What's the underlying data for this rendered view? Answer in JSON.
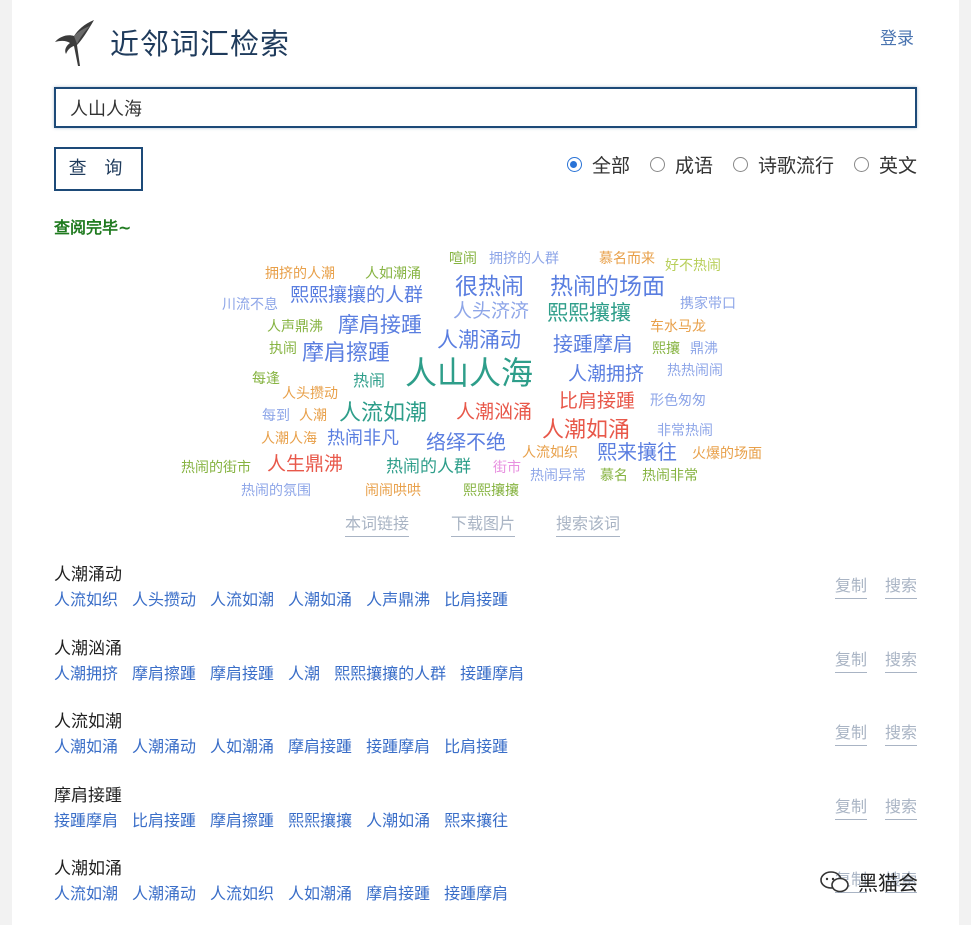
{
  "header": {
    "title": "近邻词汇检索",
    "login": "登录"
  },
  "search": {
    "value": "人山人海",
    "button": "查 询"
  },
  "filters": [
    {
      "label": "全部",
      "checked": true
    },
    {
      "label": "成语",
      "checked": false
    },
    {
      "label": "诗歌流行",
      "checked": false
    },
    {
      "label": "英文",
      "checked": false
    }
  ],
  "status": "查阅完毕~",
  "wordcloud": [
    {
      "text": "喧闹",
      "color": "#86b341"
    },
    {
      "text": "拥挤的人群",
      "color": "#8ea6e8"
    },
    {
      "text": "慕名而来",
      "color": "#e8a04a"
    },
    {
      "text": "好不热闹",
      "color": "#b8cf5a"
    },
    {
      "text": "拥挤的人潮",
      "color": "#e8a04a"
    },
    {
      "text": "人如潮涌",
      "color": "#86b341"
    },
    {
      "text": "很热闹",
      "color": "#5a7ee0"
    },
    {
      "text": "热闹的场面",
      "color": "#5a7ee0"
    },
    {
      "text": "熙熙攘攘的人群",
      "color": "#5a7ee0"
    },
    {
      "text": "川流不息",
      "color": "#8ea6e8"
    },
    {
      "text": "人头济济",
      "color": "#8ea6e8"
    },
    {
      "text": "熙熙攘攘",
      "color": "#2e9e8a"
    },
    {
      "text": "携家带口",
      "color": "#8ea6e8"
    },
    {
      "text": "人声鼎沸",
      "color": "#86b341"
    },
    {
      "text": "摩肩接踵",
      "color": "#5a7ee0"
    },
    {
      "text": "车水马龙",
      "color": "#e8a04a"
    },
    {
      "text": "人潮涌动",
      "color": "#5a7ee0"
    },
    {
      "text": "接踵摩肩",
      "color": "#5a7ee0"
    },
    {
      "text": "执闹",
      "color": "#86b341"
    },
    {
      "text": "摩肩擦踵",
      "color": "#5a7ee0"
    },
    {
      "text": "熙攘",
      "color": "#86b341"
    },
    {
      "text": "鼎沸",
      "color": "#8ea6e8"
    },
    {
      "text": "人山人海",
      "color": "#2e9e8a"
    },
    {
      "text": "人潮拥挤",
      "color": "#5a7ee0"
    },
    {
      "text": "热热闹闹",
      "color": "#8ea6e8"
    },
    {
      "text": "每逢",
      "color": "#86b341"
    },
    {
      "text": "热闹",
      "color": "#2e9e8a"
    },
    {
      "text": "人头攒动",
      "color": "#e8a04a"
    },
    {
      "text": "比肩接踵",
      "color": "#e8584a"
    },
    {
      "text": "形色匆匆",
      "color": "#8ea6e8"
    },
    {
      "text": "每到",
      "color": "#8ea6e8"
    },
    {
      "text": "人潮",
      "color": "#e8a04a"
    },
    {
      "text": "人流如潮",
      "color": "#2e9e8a"
    },
    {
      "text": "人潮汹涌",
      "color": "#e8584a"
    },
    {
      "text": "人潮如涌",
      "color": "#e8584a"
    },
    {
      "text": "非常热闹",
      "color": "#8ea6e8"
    },
    {
      "text": "人潮人海",
      "color": "#e8a04a"
    },
    {
      "text": "热闹非凡",
      "color": "#5a7ee0"
    },
    {
      "text": "络绎不绝",
      "color": "#5a7ee0"
    },
    {
      "text": "人流如织",
      "color": "#e8a04a"
    },
    {
      "text": "熙来攘往",
      "color": "#5a7ee0"
    },
    {
      "text": "火爆的场面",
      "color": "#e8a04a"
    },
    {
      "text": "热闹的街市",
      "color": "#86b341"
    },
    {
      "text": "人生鼎沸",
      "color": "#e8584a"
    },
    {
      "text": "热闹的人群",
      "color": "#2e9e8a"
    },
    {
      "text": "街市",
      "color": "#e890e0"
    },
    {
      "text": "热闹异常",
      "color": "#8ea6e8"
    },
    {
      "text": "慕名",
      "color": "#86b341"
    },
    {
      "text": "热闹非常",
      "color": "#86b341"
    },
    {
      "text": "热闹的氛围",
      "color": "#8ea6e8"
    },
    {
      "text": "闹闹哄哄",
      "color": "#e8a04a"
    },
    {
      "text": "熙熙攘攘",
      "color": "#86b341"
    }
  ],
  "cloud_actions": {
    "link": "本词链接",
    "download": "下载图片",
    "search": "搜索该词"
  },
  "results": [
    {
      "word": "人潮涌动",
      "synonyms": [
        "人流如织",
        "人头攒动",
        "人流如潮",
        "人潮如涌",
        "人声鼎沸",
        "比肩接踵"
      ]
    },
    {
      "word": "人潮汹涌",
      "synonyms": [
        "人潮拥挤",
        "摩肩擦踵",
        "摩肩接踵",
        "人潮",
        "熙熙攘攘的人群",
        "接踵摩肩"
      ]
    },
    {
      "word": "人流如潮",
      "synonyms": [
        "人潮如涌",
        "人潮涌动",
        "人如潮涌",
        "摩肩接踵",
        "接踵摩肩",
        "比肩接踵"
      ]
    },
    {
      "word": "摩肩接踵",
      "synonyms": [
        "接踵摩肩",
        "比肩接踵",
        "摩肩擦踵",
        "熙熙攘攘",
        "人潮如涌",
        "熙来攘往"
      ]
    },
    {
      "word": "人潮如涌",
      "synonyms": [
        "人流如潮",
        "人潮涌动",
        "人流如织",
        "人如潮涌",
        "摩肩接踵",
        "接踵摩肩"
      ]
    }
  ],
  "result_ops": {
    "copy": "复制",
    "search": "搜索"
  },
  "watermark": "黑猫会"
}
